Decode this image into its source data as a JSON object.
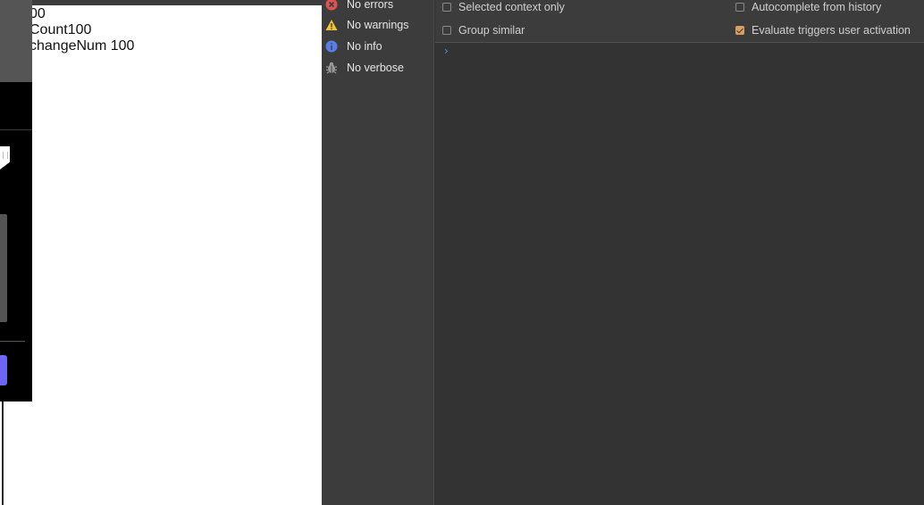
{
  "page": {
    "lines": [
      "00",
      "Count100",
      "changeNum 100"
    ]
  },
  "sidebar": {
    "items": [
      {
        "label": "No errors",
        "icon": "error-icon",
        "color": "#e05252"
      },
      {
        "label": "No warnings",
        "icon": "warning-icon",
        "color": "#f0c232"
      },
      {
        "label": "No info",
        "icon": "info-icon",
        "color": "#5a7de6"
      },
      {
        "label": "No verbose",
        "icon": "verbose-icon",
        "color": "#9a9a9a"
      }
    ]
  },
  "settings": {
    "selected_context_only": {
      "label": "Selected context only",
      "checked": false
    },
    "group_similar": {
      "label": "Group similar",
      "checked": false
    },
    "autocomplete_from_history": {
      "label": "Autocomplete from history",
      "checked": false
    },
    "evaluate_triggers_user_activation": {
      "label": "Evaluate triggers user activation",
      "checked": true
    }
  },
  "console": {
    "prompt_icon": "chevron-right-icon",
    "prompt_glyph": "›",
    "prompt_color": "#5b8de8"
  }
}
